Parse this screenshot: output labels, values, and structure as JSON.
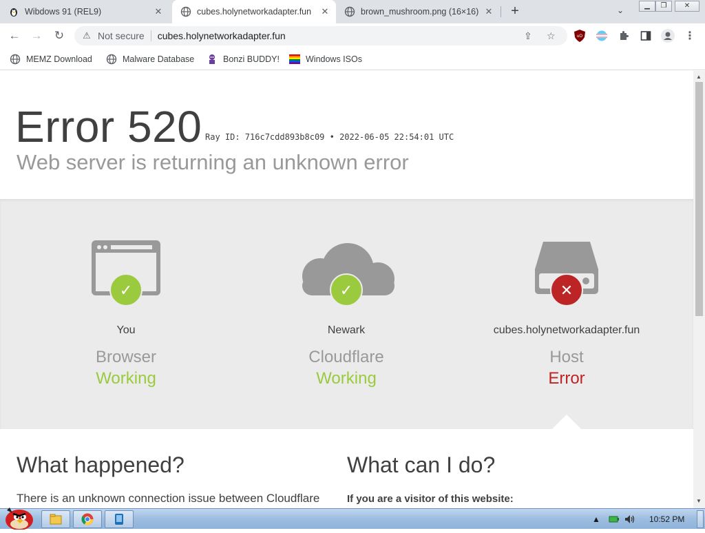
{
  "tabs": [
    {
      "title": "Wibdows 91 (REL9)",
      "icon": "penguin-icon",
      "active": false
    },
    {
      "title": "cubes.holynetworkadapter.fun",
      "icon": "globe-icon",
      "active": true
    },
    {
      "title": "brown_mushroom.png (16×16)",
      "icon": "globe-icon",
      "active": false
    }
  ],
  "toolbar": {
    "security_label": "Not secure",
    "url": "cubes.holynetworkadapter.fun"
  },
  "bookmarks": [
    {
      "label": "MEMZ Download",
      "icon": "globe-icon"
    },
    {
      "label": "Malware Database",
      "icon": "globe-icon"
    },
    {
      "label": "Bonzi BUDDY!",
      "icon": "bonzi-icon"
    },
    {
      "label": "Windows ISOs",
      "icon": "rainbow-flag-icon"
    }
  ],
  "page": {
    "error_code": "Error 520",
    "ray_id": "Ray ID: 716c7cdd893b8c09 • 2022-06-05 22:54:01 UTC",
    "subtitle": "Web server is returning an unknown error",
    "nodes": [
      {
        "location": "You",
        "kind": "Browser",
        "status": "Working",
        "state": "ok",
        "icon": "browser-window-icon"
      },
      {
        "location": "Newark",
        "kind": "Cloudflare",
        "status": "Working",
        "state": "ok",
        "icon": "cloud-icon"
      },
      {
        "location": "cubes.holynetworkadapter.fun",
        "kind": "Host",
        "status": "Error",
        "state": "error",
        "icon": "server-icon"
      }
    ],
    "what_happened": {
      "heading": "What happened?",
      "text": "There is an unknown connection issue between Cloudflare"
    },
    "what_can_i_do": {
      "heading": "What can I do?",
      "text": "If you are a visitor of this website:"
    }
  },
  "taskbar": {
    "clock": "10:52 PM"
  },
  "colors": {
    "ok": "#9bca3e",
    "error": "#bd2426",
    "gray_icon": "#999999",
    "diagram_bg": "#ebebeb"
  }
}
